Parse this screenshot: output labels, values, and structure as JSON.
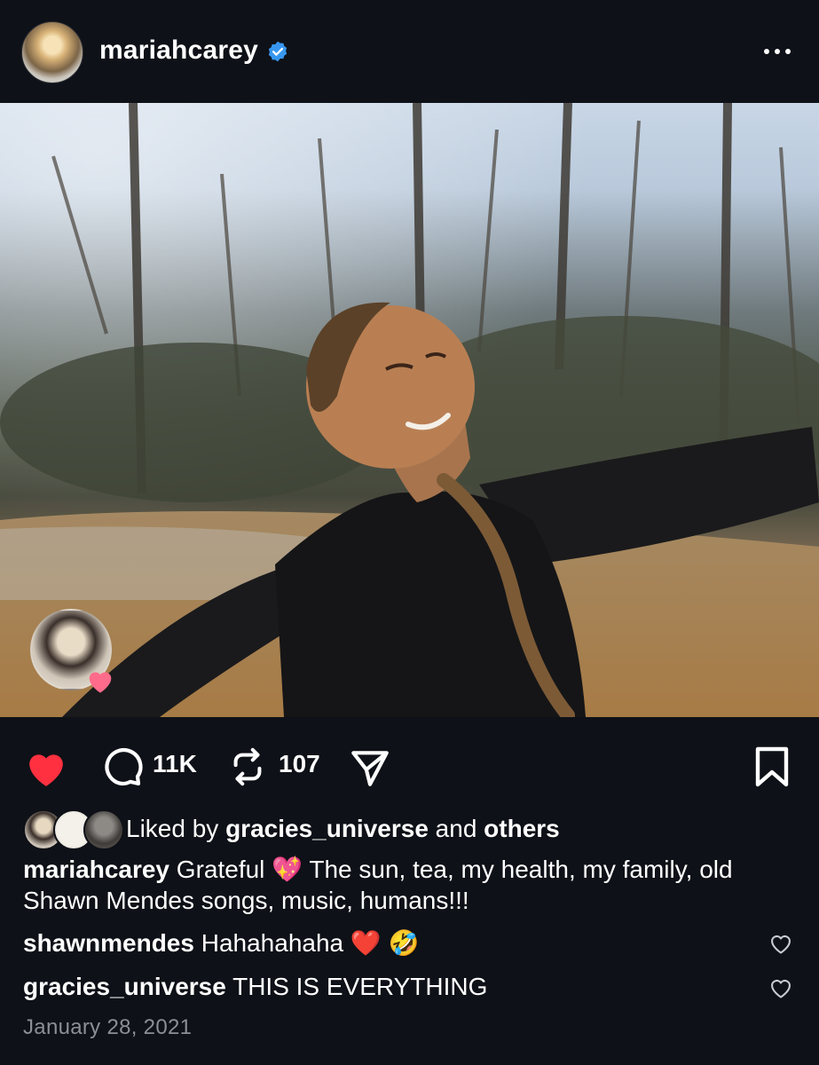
{
  "post": {
    "username": "mariahcarey",
    "likes": {
      "prefix": "Liked by",
      "user": "gracies_universe",
      "conjunction": "and",
      "others": "others"
    },
    "caption": {
      "author": "mariahcarey",
      "text_before_emoji": "Grateful",
      "emoji": "💖",
      "text_after_emoji": "The sun, tea, my health, my family, old Shawn Mendes songs, music, humans!!!"
    },
    "comments": [
      {
        "author": "shawnmendes",
        "text": "Hahahahaha ❤️ 🤣"
      },
      {
        "author": "gracies_universe",
        "text": "THIS IS EVERYTHING"
      }
    ],
    "date": "January 28, 2021"
  },
  "actions": {
    "comments_count": "11K",
    "reposts_count": "107"
  },
  "colors": {
    "background": "#0e1117",
    "like_active": "#ff3040",
    "verified_badge": "#3797f0",
    "secondary_text": "#8b8f96"
  },
  "icons": {
    "verified": "verified-badge-icon",
    "more": "more-horizontal-icon",
    "like": "heart-filled-icon",
    "comment": "comment-bubble-icon",
    "repost": "repost-icon",
    "share": "paper-plane-icon",
    "save": "bookmark-icon",
    "comment_like": "heart-outline-icon"
  }
}
